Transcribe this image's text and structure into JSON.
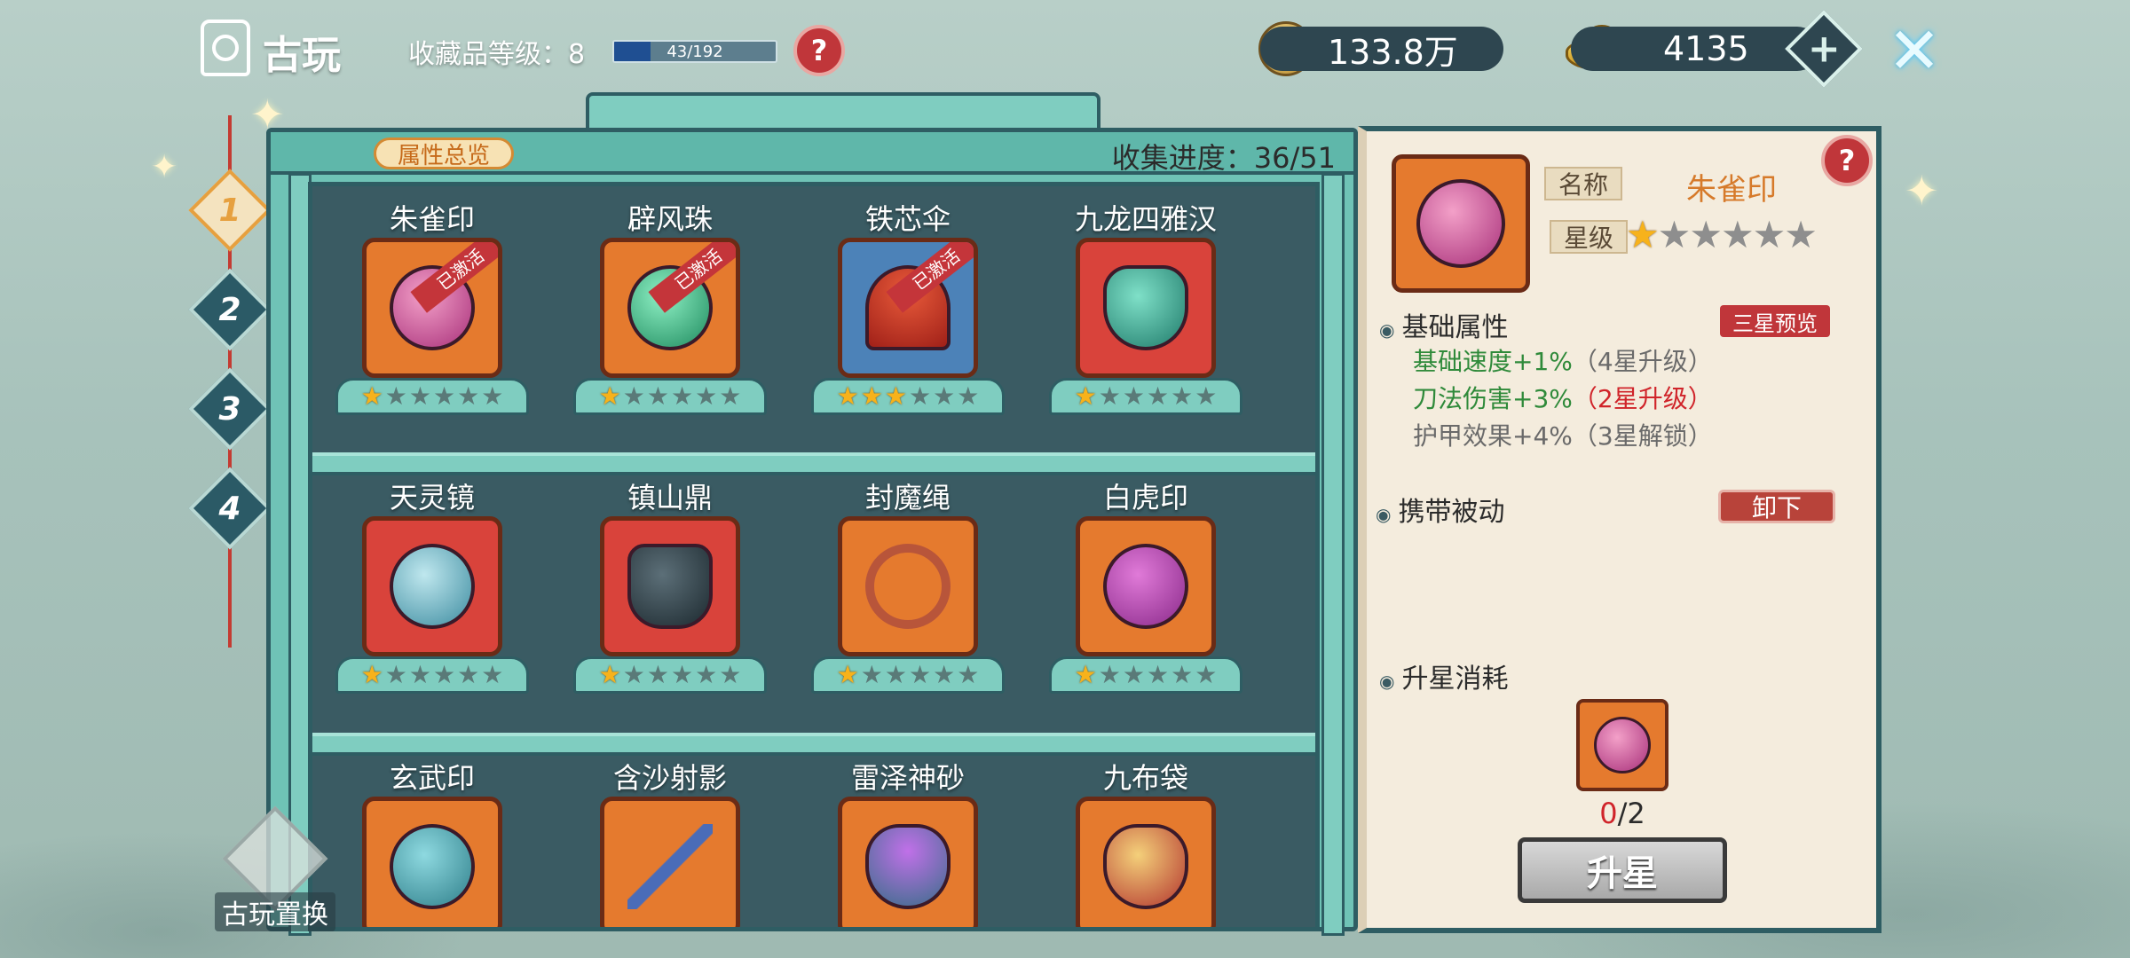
{
  "header": {
    "title": "古玩",
    "level_label": "收藏品等级：8",
    "level_progress_text": "43/192",
    "level_progress_fraction": 0.224,
    "help": "?"
  },
  "currency": {
    "copper": "133.8万",
    "gold": "4135",
    "add": "+",
    "close": "✕"
  },
  "side_tabs": [
    "1",
    "2",
    "3",
    "4"
  ],
  "shelf": {
    "attr_overview": "属性总览",
    "collect_progress": "收集进度：36/51",
    "swap_label": "古玩置换",
    "activated_label": "已激活",
    "items": [
      {
        "name": "朱雀印",
        "stars": 1,
        "activated": true,
        "bg": "orange",
        "art": "seal",
        "selected": true
      },
      {
        "name": "辟风珠",
        "stars": 1,
        "activated": true,
        "bg": "orange",
        "art": "teal"
      },
      {
        "name": "铁芯伞",
        "stars": 3,
        "activated": true,
        "bg": "blue",
        "art": "umbrella"
      },
      {
        "name": "九龙四雅汉",
        "stars": 1,
        "activated": false,
        "bg": "red",
        "art": "vase"
      },
      {
        "name": "天灵镜",
        "stars": 1,
        "activated": false,
        "bg": "red",
        "art": "mirror"
      },
      {
        "name": "镇山鼎",
        "stars": 1,
        "activated": false,
        "bg": "red",
        "art": "ding"
      },
      {
        "name": "封魔绳",
        "stars": 1,
        "activated": false,
        "bg": "orange",
        "art": "rope"
      },
      {
        "name": "白虎印",
        "stars": 1,
        "activated": false,
        "bg": "orange",
        "art": "tiger"
      },
      {
        "name": "玄武印",
        "stars": 0,
        "activated": false,
        "bg": "orange",
        "art": "turtle"
      },
      {
        "name": "含沙射影",
        "stars": 0,
        "activated": false,
        "bg": "orange",
        "art": "brush"
      },
      {
        "name": "雷泽神砂",
        "stars": 0,
        "activated": false,
        "bg": "orange",
        "art": "sand"
      },
      {
        "name": "九布袋",
        "stars": 0,
        "activated": false,
        "bg": "orange",
        "art": "bag"
      }
    ]
  },
  "detail": {
    "name_tag": "名称",
    "name": "朱雀印",
    "star_tag": "星级",
    "stars": 1,
    "max_stars": 6,
    "base_attr_title": "基础属性",
    "preview_button": "三星预览",
    "attrs": [
      {
        "text": "基础速度+1%",
        "note": "（4星升级）",
        "color": "green",
        "note_color": "gray"
      },
      {
        "text": "刀法伤害+3%",
        "note": "（2星升级）",
        "color": "green",
        "note_color": "red"
      },
      {
        "text": "护甲效果+4%",
        "note": "（3星解锁）",
        "color": "gray",
        "note_color": "gray"
      }
    ],
    "passive_title": "携带被动",
    "unequip_button": "卸下",
    "upgrade_cost_title": "升星消耗",
    "cost_have": "0",
    "cost_need": "/2",
    "upgrade_button": "升星"
  },
  "colors": {
    "panel_border": "#2e5d63",
    "shelf_light": "#7fcdc0",
    "star_on": "#f7b21b",
    "accent_red": "#c0363a"
  }
}
